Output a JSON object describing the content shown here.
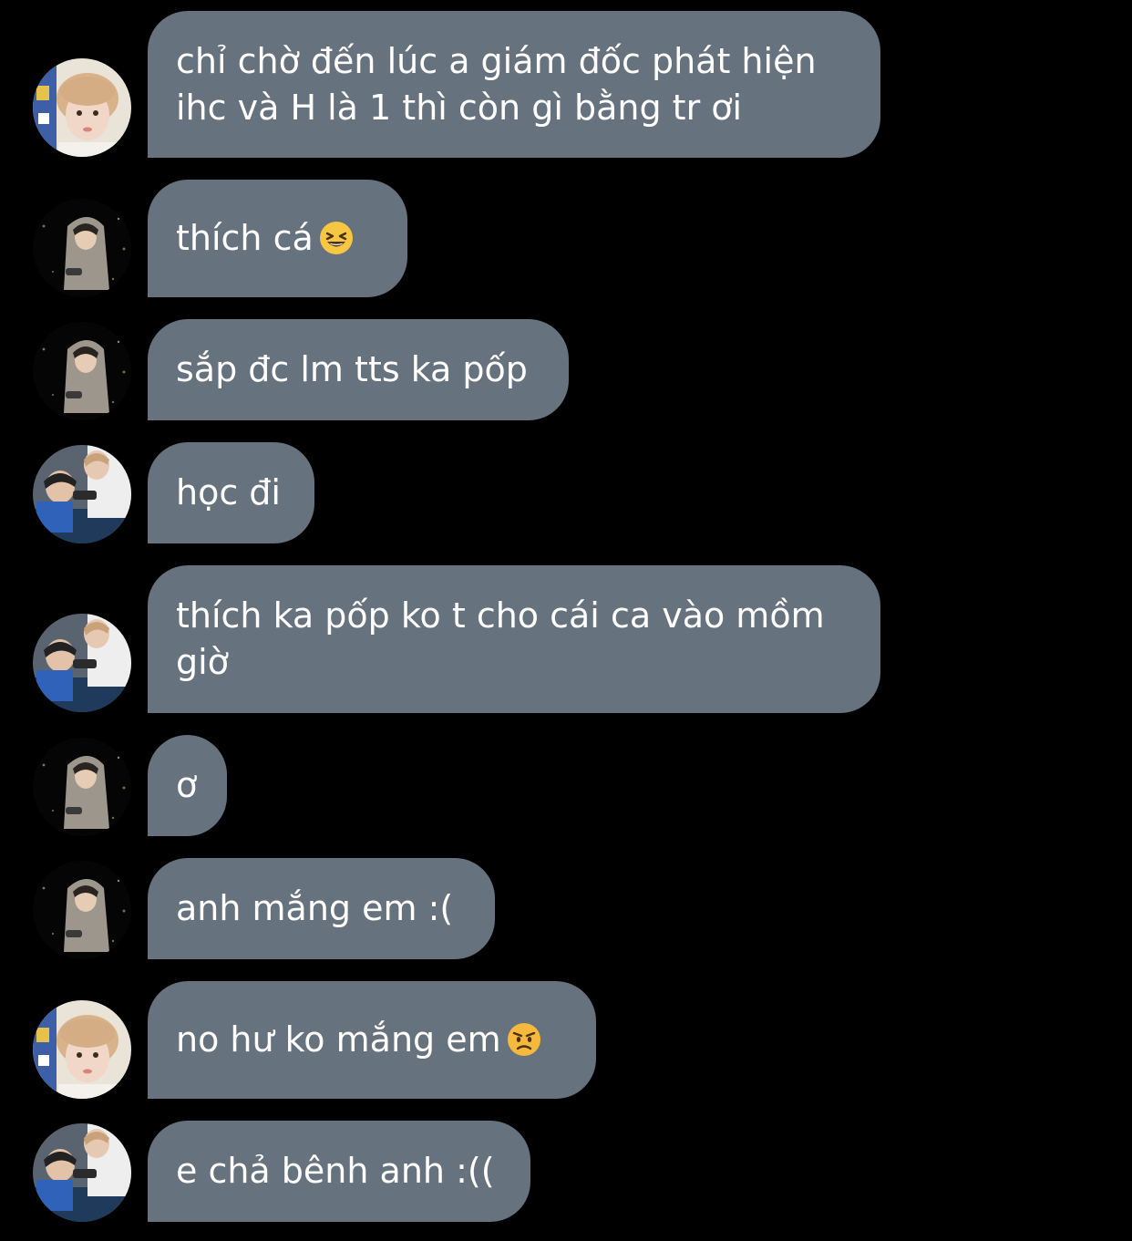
{
  "messages": [
    {
      "sender": "blonde-boy",
      "text": "chỉ chờ đến lúc a giám đốc phát hiện ihc và H là 1 thì còn gì bằng tr ơi"
    },
    {
      "sender": "hooded-boy",
      "text": "thích cá",
      "emoji": "grinning-squinting-face"
    },
    {
      "sender": "hooded-boy",
      "text": "sắp đc lm tts ka pốp"
    },
    {
      "sender": "two-boys",
      "text": "học đi"
    },
    {
      "sender": "two-boys",
      "text": "thích ka pốp ko t cho cái ca vào mồm giờ"
    },
    {
      "sender": "hooded-boy",
      "text": "ơ"
    },
    {
      "sender": "hooded-boy",
      "text": "anh mắng em :("
    },
    {
      "sender": "blonde-boy",
      "text": "no hư ko mắng em",
      "emoji": "angry-face"
    },
    {
      "sender": "two-boys",
      "text": "e chả bênh anh :(("
    }
  ],
  "colors": {
    "background": "#000000",
    "bubble": "#67727f",
    "text": "#ffffff"
  }
}
